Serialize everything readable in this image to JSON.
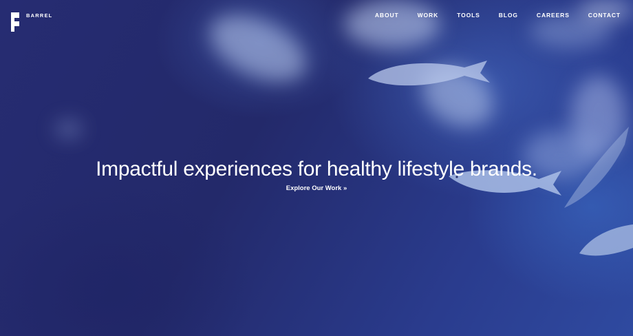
{
  "brand": {
    "name": "BARREL",
    "logo": "barrel-logo-icon"
  },
  "nav": {
    "items": [
      {
        "label": "ABOUT"
      },
      {
        "label": "WORK"
      },
      {
        "label": "TOOLS"
      },
      {
        "label": "BLOG"
      },
      {
        "label": "CAREERS"
      },
      {
        "label": "CONTACT"
      }
    ]
  },
  "hero": {
    "headline": "Impactful experiences for healthy lifestyle brands.",
    "cta_label": "Explore Our Work »"
  },
  "colors": {
    "background": "#232a6b",
    "text": "#ffffff"
  }
}
